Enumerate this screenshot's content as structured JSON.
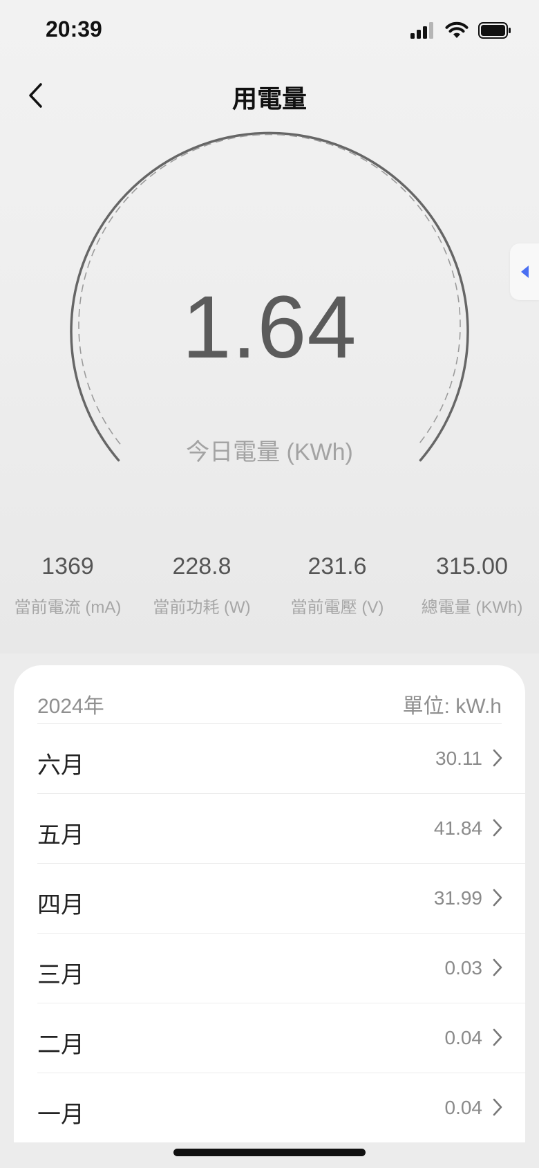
{
  "status_bar": {
    "time": "20:39"
  },
  "header": {
    "title": "用電量"
  },
  "gauge": {
    "value": "1.64",
    "label": "今日電量 (KWh)"
  },
  "stats": [
    {
      "value": "1369",
      "label": "當前電流 (mA)"
    },
    {
      "value": "228.8",
      "label": "當前功耗 (W)"
    },
    {
      "value": "231.6",
      "label": "當前電壓 (V)"
    },
    {
      "value": "315.00",
      "label": "總電量 (KWh)"
    }
  ],
  "monthly": {
    "year": "2024年",
    "unit": "單位: kW.h",
    "rows": [
      {
        "month": "六月",
        "value": "30.11"
      },
      {
        "month": "五月",
        "value": "41.84"
      },
      {
        "month": "四月",
        "value": "31.99"
      },
      {
        "month": "三月",
        "value": "0.03"
      },
      {
        "month": "二月",
        "value": "0.04"
      },
      {
        "month": "一月",
        "value": "0.04"
      }
    ]
  },
  "colors": {
    "accent": "#4a6ff2",
    "gauge_stroke": "#666666",
    "text_primary": "#222222",
    "text_secondary": "#8a8a8a"
  },
  "icons": {
    "back": "chevron-left-icon",
    "side_tab": "triangle-left-icon",
    "row": "chevron-right-icon"
  }
}
